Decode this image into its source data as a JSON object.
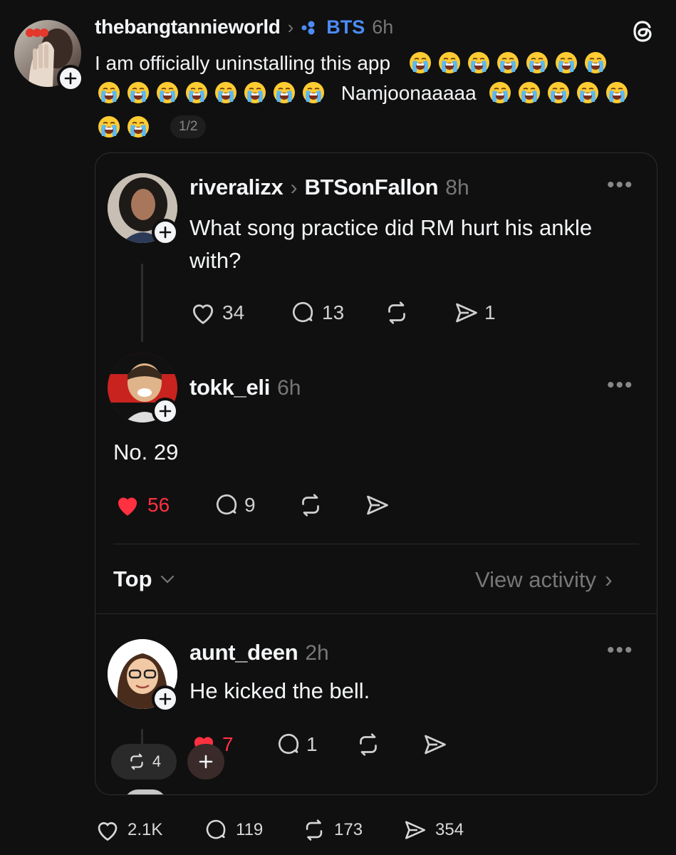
{
  "post": {
    "username": "thebangtannieworld",
    "community": "BTS",
    "time": "6h",
    "text_line1": "I am officially uninstalling this app",
    "text_line2_word": "Namjoonaaaaa",
    "page_counter": "1/2",
    "stats": {
      "likes": "2.1K",
      "comments": "119",
      "reposts": "173",
      "shares": "354"
    }
  },
  "quoted": {
    "username": "riveralizx",
    "community": "BTSonFallon",
    "time": "8h",
    "text_line1": "What song practice did RM hurt his ankle",
    "text_line2": "with?",
    "stats": {
      "likes": "34",
      "comments": "13",
      "shares": "1"
    }
  },
  "reply": {
    "username": "tokk_eli",
    "time": "6h",
    "text": "No. 29",
    "stats": {
      "likes": "56",
      "comments": "9"
    }
  },
  "sort": {
    "label": "Top",
    "view_activity": "View activity"
  },
  "comment": {
    "username": "aunt_deen",
    "time": "2h",
    "text": "He kicked the bell.",
    "stats": {
      "likes": "7",
      "comments": "1"
    }
  },
  "floating": {
    "repost_count": "4"
  },
  "icons": {
    "app_logo": "threads-logo-icon",
    "emoji": "loudly-crying-face-icon"
  },
  "colors": {
    "accent_blue": "#4b8cf7",
    "like_red": "#ff3040",
    "background": "#101010"
  }
}
